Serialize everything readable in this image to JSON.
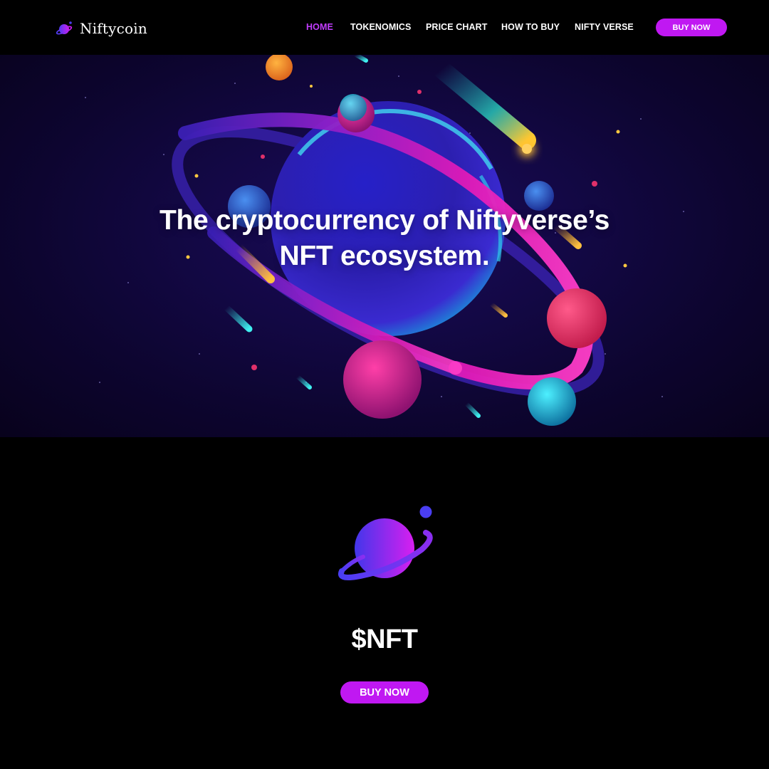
{
  "brand": {
    "name": "Niftycoin",
    "logo_icon": "planet-icon",
    "accent_color": "#c018f2"
  },
  "nav": {
    "items": [
      {
        "label": "HOME",
        "active": true
      },
      {
        "label": "TOKENOMICS",
        "active": false
      },
      {
        "label": "PRICE CHART",
        "active": false
      },
      {
        "label": "HOW TO BUY",
        "active": false
      },
      {
        "label": "NIFTY VERSE",
        "active": false
      }
    ],
    "buy_label": "BUY NOW",
    "active_color": "#c23dff"
  },
  "hero": {
    "title_line1": "The cryptocurrency of Niftyverse’s",
    "title_line2": "NFT ecosystem."
  },
  "token": {
    "logo_icon": "planet-icon",
    "ticker": "$NFT",
    "cta_label": "BUY NOW"
  }
}
